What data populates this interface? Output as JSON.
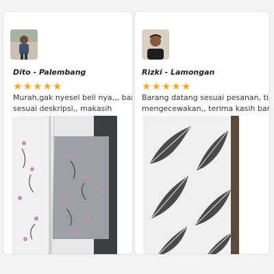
{
  "reviews": [
    {
      "name": "Dito - Palembang",
      "rating": 5,
      "stars_text": "★★★★★",
      "review_line1": "Murah,gak nyesel beli nya,,, barang",
      "review_line2": "sesuai deskripsi,, makasih",
      "photo_icon": "floral-curtain-photo"
    },
    {
      "name": "Rizki - Lamongan",
      "rating": 5,
      "stars_text": "★★★★★",
      "review_line1": "Barang datang sesuai pesanan, tidak",
      "review_line2": "mengecewakan,, terima kasih banyak",
      "photo_icon": "feather-curtain-photo"
    }
  ],
  "colors": {
    "star": "#f5a623",
    "card_bg": "#ffffff",
    "page_bg": "#f3f3f3"
  }
}
